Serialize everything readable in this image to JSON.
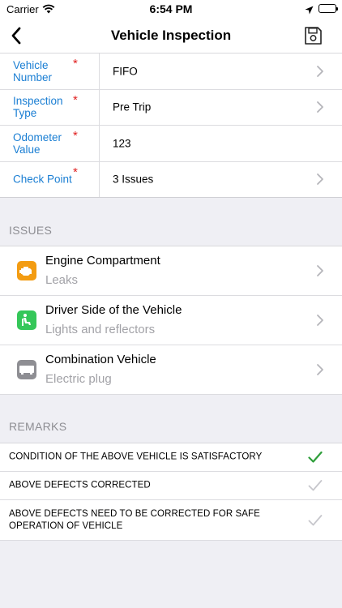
{
  "status_bar": {
    "carrier": "Carrier",
    "time": "6:54 PM"
  },
  "nav": {
    "title": "Vehicle Inspection",
    "back_icon": "chevron-left-icon",
    "save_icon": "save-icon"
  },
  "form": {
    "rows": [
      {
        "label": "Vehicle Number",
        "required": "*",
        "value": "FIFO",
        "has_chevron": true
      },
      {
        "label": "Inspection Type",
        "required": "*",
        "value": "Pre Trip",
        "has_chevron": true
      },
      {
        "label": "Odometer Value",
        "required": "*",
        "value": "123",
        "has_chevron": false
      },
      {
        "label": "Check Point",
        "required": "*",
        "value": "3 Issues",
        "has_chevron": true
      }
    ]
  },
  "issues": {
    "header": "ISSUES",
    "items": [
      {
        "title": "Engine Compartment",
        "subtitle": "Leaks",
        "icon": "engine-icon",
        "icon_color": "#f39c12"
      },
      {
        "title": "Driver Side of the Vehicle",
        "subtitle": "Lights and reflectors",
        "icon": "driver-seat-icon",
        "icon_color": "#35c759"
      },
      {
        "title": "Combination Vehicle",
        "subtitle": "Electric plug",
        "icon": "trailer-icon",
        "icon_color": "#8e8e93"
      }
    ]
  },
  "remarks": {
    "header": "REMARKS",
    "items": [
      {
        "text": "CONDITION OF THE ABOVE VEHICLE IS SATISFACTORY",
        "checked": true
      },
      {
        "text": "ABOVE DEFECTS CORRECTED",
        "checked": false
      },
      {
        "text": "ABOVE DEFECTS NEED TO BE CORRECTED FOR SAFE OPERATION OF VEHICLE",
        "checked": false
      }
    ]
  },
  "colors": {
    "accent": "#1a7ed3",
    "required": "#e02020",
    "check_on": "#2e9e3a",
    "check_off": "#c7c7cc"
  }
}
